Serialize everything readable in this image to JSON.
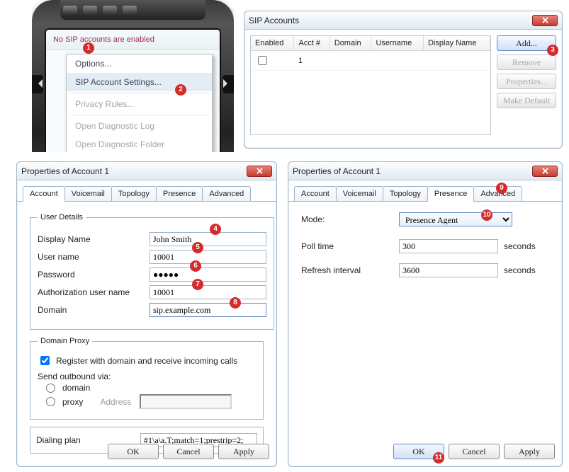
{
  "phone": {
    "status": "No SIP accounts are enabled",
    "menu": {
      "options": "Options...",
      "sip": "SIP Account Settings...",
      "privacy": "Privacy Rules...",
      "diag_log": "Open Diagnostic Log",
      "diag_folder": "Open Diagnostic Folder"
    }
  },
  "sip_window": {
    "title": "SIP Accounts",
    "cols": {
      "enabled": "Enabled",
      "acct": "Acct #",
      "domain": "Domain",
      "user": "Username",
      "display": "Display Name"
    },
    "row": {
      "acct": "1"
    },
    "buttons": {
      "add": "Add...",
      "remove": "Remove",
      "props": "Properties...",
      "default": "Make Default"
    }
  },
  "props_account": {
    "title": "Properties of Account 1",
    "tabs": {
      "account": "Account",
      "voicemail": "Voicemail",
      "topology": "Topology",
      "presence": "Presence",
      "advanced": "Advanced"
    },
    "user_details": {
      "legend": "User Details",
      "display_name": {
        "label": "Display Name",
        "value": "John Smith"
      },
      "username": {
        "label": "User name",
        "value": "10001"
      },
      "password": {
        "label": "Password",
        "value": "●●●●●"
      },
      "auth": {
        "label": "Authorization user name",
        "value": "10001"
      },
      "domain": {
        "label": "Domain",
        "value": "sip.example.com"
      }
    },
    "domain_proxy": {
      "legend": "Domain Proxy",
      "register": "Register with domain and receive incoming calls",
      "send_label": "Send outbound via:",
      "opt_domain": "domain",
      "opt_proxy": "proxy",
      "addr_label": "Address"
    },
    "dialing_plan": {
      "label": "Dialing plan",
      "value": "#1\\a\\a.T;match=1;prestrip=2;"
    },
    "buttons": {
      "ok": "OK",
      "cancel": "Cancel",
      "apply": "Apply"
    }
  },
  "props_presence": {
    "title": "Properties of Account 1",
    "mode": {
      "label": "Mode:",
      "value": "Presence Agent"
    },
    "poll": {
      "label": "Poll time",
      "value": "300",
      "unit": "seconds"
    },
    "refresh": {
      "label": "Refresh interval",
      "value": "3600",
      "unit": "seconds"
    },
    "buttons": {
      "ok": "OK",
      "cancel": "Cancel",
      "apply": "Apply"
    }
  },
  "badges": {
    "1": "1",
    "2": "2",
    "3": "3",
    "4": "4",
    "5": "5",
    "6": "6",
    "7": "7",
    "8": "8",
    "9": "9",
    "10": "10",
    "11": "11"
  }
}
